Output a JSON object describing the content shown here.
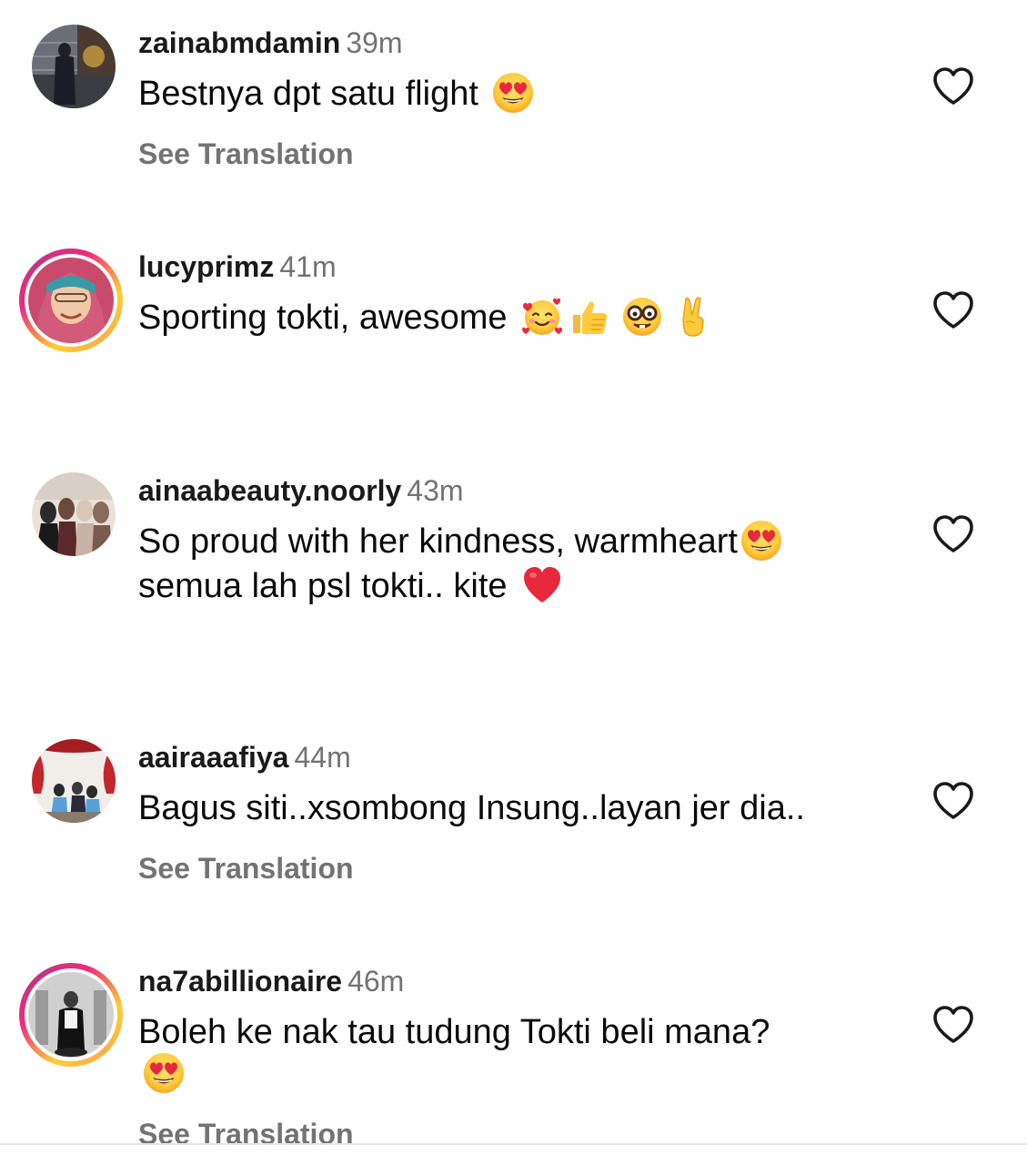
{
  "comments": [
    {
      "username": "zainabmdamin",
      "time": "39m",
      "text": "Bestnya dpt satu flight",
      "emojis": [
        "heart-eyes-emoji"
      ],
      "see_translation": "See Translation",
      "has_story": false
    },
    {
      "username": "lucyprimz",
      "time": "41m",
      "text": "Sporting tokti, awesome",
      "emojis": [
        "smiling-face-with-hearts-emoji",
        "thumbs-up-emoji",
        "nerd-face-emoji",
        "victory-hand-emoji"
      ],
      "has_story": true
    },
    {
      "username": "ainaabeauty.noorly",
      "time": "43m",
      "text_line1": "So proud with her kindness, warmheart",
      "text_line2": "semua lah psl tokti.. kite",
      "emojis": [
        "heart-eyes-emoji",
        "red-heart-emoji"
      ],
      "has_story": false
    },
    {
      "username": "aairaaafiya",
      "time": "44m",
      "text": "Bagus siti..xsombong Insung..layan jer dia..",
      "see_translation": "See Translation",
      "has_story": false
    },
    {
      "username": "na7abillionaire",
      "time": "46m",
      "text": "Boleh ke nak tau tudung Tokti beli mana?",
      "emojis": [
        "heart-eyes-emoji"
      ],
      "see_translation": "See Translation",
      "has_story": true
    }
  ],
  "icons": {
    "like": "heart-outline-icon"
  },
  "colors": {
    "username": "#1a1a1a",
    "secondary": "#737373",
    "story_ring_start": "#f9ce34",
    "story_ring_mid": "#ee2a7b",
    "story_ring_end": "#c13584"
  }
}
